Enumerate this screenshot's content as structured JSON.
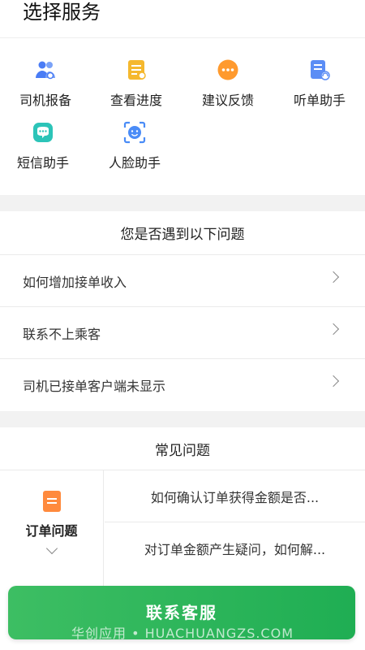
{
  "page": {
    "title": "选择服务"
  },
  "services": [
    {
      "label": "司机报备",
      "icon": "users-icon",
      "color": "#4a7cf5"
    },
    {
      "label": "查看进度",
      "icon": "progress-list-icon",
      "color": "#f5b82e"
    },
    {
      "label": "建议反馈",
      "icon": "more-dots-icon",
      "color": "#ff9a2e"
    },
    {
      "label": "听单助手",
      "icon": "document-headset-icon",
      "color": "#5b8df5"
    },
    {
      "label": "短信助手",
      "icon": "message-icon",
      "color": "#2cc4b8"
    },
    {
      "label": "人脸助手",
      "icon": "face-scan-icon",
      "color": "#4a8cf7"
    }
  ],
  "questions": {
    "title": "您是否遇到以下问题",
    "items": [
      "如何增加接单收入",
      "联系不上乘客",
      "司机已接单客户端未显示"
    ]
  },
  "faq": {
    "title": "常见问题",
    "category": {
      "label": "订单问题",
      "icon": "document-icon",
      "color": "#ff8a3d"
    },
    "items": [
      "如何确认订单获得金额是否...",
      "对订单金额产生疑问，如何解..."
    ]
  },
  "contact_button": {
    "label": "联系客服",
    "color": "#2db45a"
  },
  "watermark": "华创应用 • HUACHUANGZS.COM"
}
